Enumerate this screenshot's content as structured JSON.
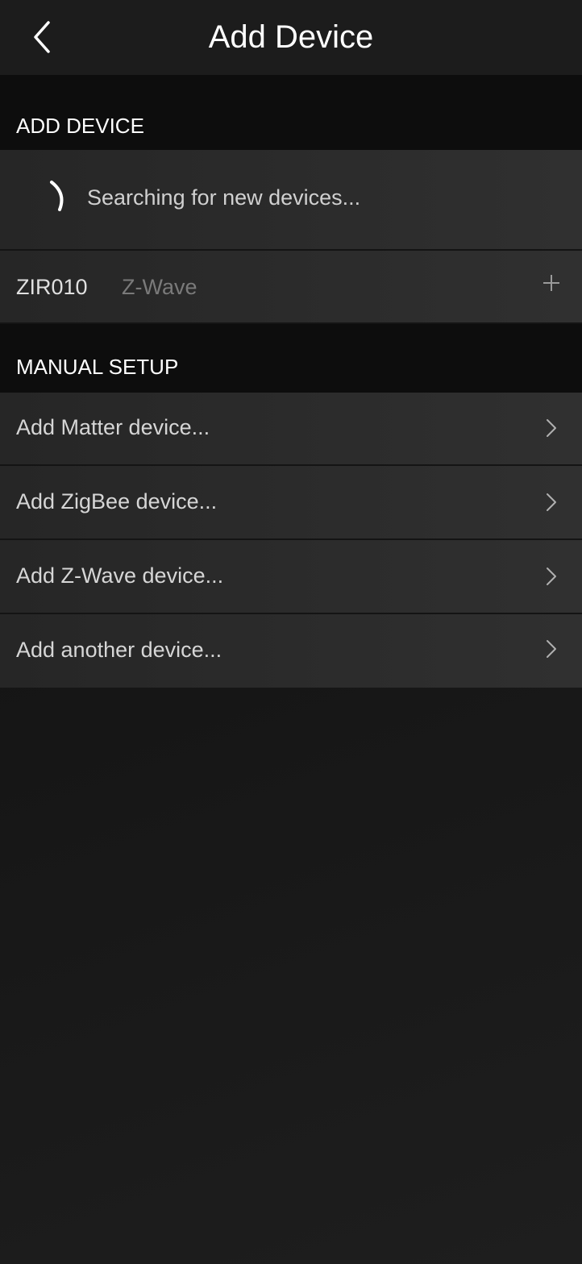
{
  "header": {
    "title": "Add Device",
    "back_icon": "chevron-left-icon"
  },
  "discovery_section": {
    "label": "ADD DEVICE",
    "searching_text": "Searching for new devices...",
    "spinner_icon": "loading-spinner-icon",
    "found_devices": [
      {
        "name": "ZIR010",
        "protocol": "Z-Wave",
        "action_icon": "plus-icon"
      }
    ]
  },
  "manual_section": {
    "label": "MANUAL SETUP",
    "items": [
      {
        "label": "Add Matter device...",
        "icon": "chevron-right-icon"
      },
      {
        "label": "Add ZigBee device...",
        "icon": "chevron-right-icon"
      },
      {
        "label": "Add Z-Wave device...",
        "icon": "chevron-right-icon"
      },
      {
        "label": "Add another device...",
        "icon": "chevron-right-icon"
      }
    ]
  },
  "colors": {
    "background": "#151515",
    "row": "#2a2a2a",
    "section_header": "#0d0d0d",
    "text_primary": "#ffffff",
    "text_secondary": "#d6d6d6",
    "text_muted": "#7a7a7a"
  }
}
